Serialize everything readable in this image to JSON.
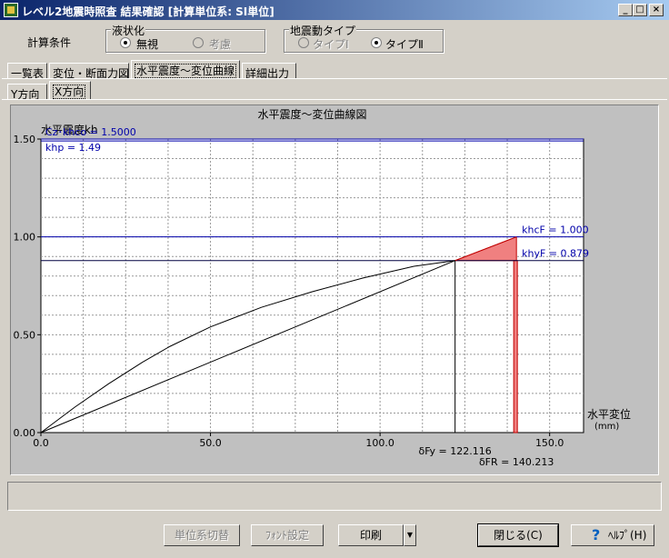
{
  "window": {
    "title": "レベル2地震時照査 結果確認 [計算単位系: SI単位]",
    "controls": [
      "_",
      "□",
      "×"
    ]
  },
  "conditions": {
    "label": "計算条件",
    "liquefaction": {
      "legend": "液状化",
      "options": [
        "無視",
        "考慮"
      ],
      "selected": "無視"
    },
    "seismic": {
      "legend": "地震動タイプ",
      "options": [
        "タイプⅠ",
        "タイプⅡ"
      ],
      "selected": "タイプⅡ"
    }
  },
  "tabs": [
    "一覧表",
    "変位・断面力図",
    "水平震度～変位曲線",
    "詳細出力"
  ],
  "active_tab": "水平震度～変位曲線",
  "subtabs": [
    "Y方向",
    "X方向"
  ],
  "active_subtab": "X方向",
  "chart_data": {
    "type": "line",
    "title": "水平震度～変位曲線図",
    "ylabel": "水平震度kh",
    "xlabel": "水平変位",
    "xunit": "(mm)",
    "xlim": [
      0,
      160
    ],
    "ylim": [
      0,
      1.5
    ],
    "xticks": [
      "0.0",
      "50.0",
      "100.0",
      "150.0"
    ],
    "xtick_values": [
      0,
      50,
      100,
      150
    ],
    "yticks": [
      "0.00",
      "0.50",
      "1.00",
      "1.50"
    ],
    "ytick_values": [
      0,
      0.5,
      1.0,
      1.5
    ],
    "grid": true,
    "curves": {
      "upper": {
        "x": [
          0,
          10,
          20,
          30,
          38,
          50,
          65,
          80,
          95,
          110,
          122.116
        ],
        "y": [
          0,
          0.13,
          0.25,
          0.36,
          0.44,
          0.54,
          0.64,
          0.72,
          0.79,
          0.85,
          0.879
        ]
      },
      "lower": {
        "x": [
          0,
          122.116
        ],
        "y": [
          0,
          0.879
        ]
      },
      "extension": {
        "x": [
          122.116,
          140.213
        ],
        "y": [
          0.879,
          1.0
        ]
      }
    },
    "reference_lines": [
      {
        "label": "Cz･khco = 1.5000",
        "y": 1.5
      },
      {
        "label": "khp = 1.49",
        "y": 1.49
      },
      {
        "label": "khcF = 1.000",
        "y": 1.0
      },
      {
        "label": "khyF = 0.879",
        "y": 0.879
      }
    ],
    "markers": [
      {
        "label": "δFy = 122.116",
        "x": 122.116
      },
      {
        "label": "δFR = 140.213",
        "x": 140.213
      }
    ],
    "colors": {
      "curve": "#000000",
      "reference": "#0000aa",
      "fill": "#f08080",
      "plot_bg": "#ffffff",
      "frame_bg": "#c0c0c0"
    }
  },
  "footer": {
    "buttons": {
      "unit_switch": "単位系切替",
      "font": "ﾌｫﾝﾄ設定",
      "print": "印刷",
      "close": "閉じる(C)",
      "help": "ﾍﾙﾌﾟ(H)"
    }
  }
}
